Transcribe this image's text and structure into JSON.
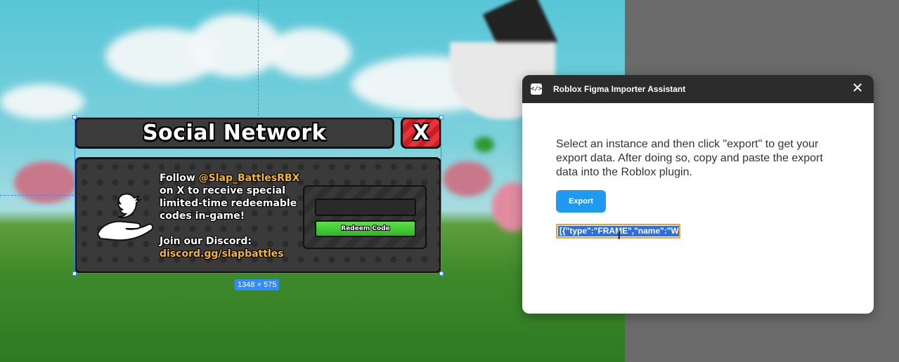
{
  "game_ui": {
    "title": "Social Network",
    "close_label": "X",
    "follow_prefix": "Follow ",
    "handle": "@Slap_BattlesRBX",
    "follow_suffix": "on X to receive special limited-time redeemable codes in-game!",
    "discord_label": "Join our Discord:",
    "discord_link": "discord.gg/slapbattles",
    "code_input_value": "",
    "redeem_label": "Redeem Code"
  },
  "selection": {
    "dimensions": "1348 × 575"
  },
  "plugin": {
    "title": "Roblox Figma Importer Assistant",
    "icon_glyph": "</>",
    "close_glyph": "✕",
    "description": "Select an instance and then click \"export\" to get your export data. After doing so, copy and paste the export data into the Roblox plugin.",
    "export_label": "Export",
    "export_value": "[{\"type\":\"FRAME\",\"name\":\"W"
  },
  "colors": {
    "accent": "#1e9bf0",
    "highlight_text": "#f7b733",
    "redeem_green": "#3ccf2e",
    "close_red": "#e5353a",
    "selection_blue": "#2f8bff"
  }
}
